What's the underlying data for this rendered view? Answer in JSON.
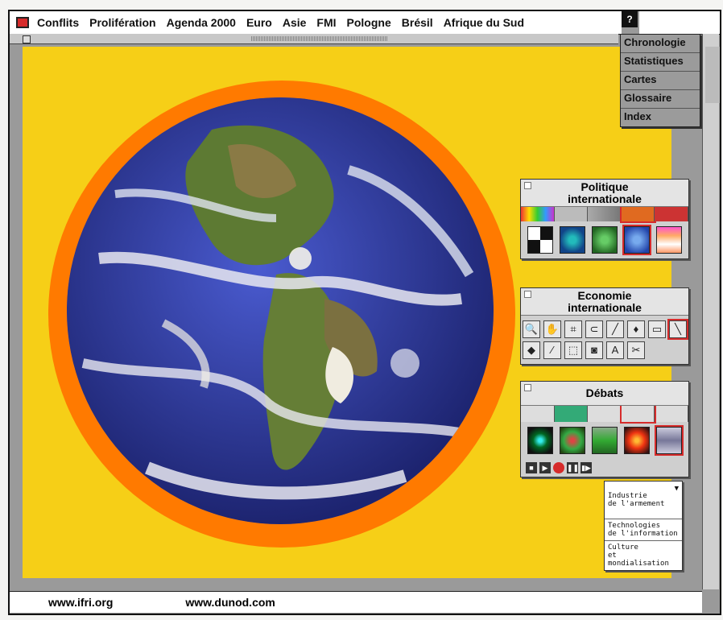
{
  "menubar": {
    "items": [
      "Conflits",
      "Prolifération",
      "Agenda 2000",
      "Euro",
      "Asie",
      "FMI",
      "Pologne",
      "Brésil",
      "Afrique du Sud"
    ],
    "help_label": "?"
  },
  "help_menu": {
    "items": [
      "Chronologie",
      "Statistiques",
      "Cartes",
      "Glossaire",
      "Index"
    ]
  },
  "palettes": {
    "politique": {
      "title_line1": "Politique",
      "title_line2": "internationale"
    },
    "economie": {
      "title_line1": "Economie",
      "title_line2": "internationale"
    },
    "debats": {
      "title": "Débats"
    }
  },
  "popup": {
    "items": [
      "Industrie\nde l'armement",
      "Technologies\nde l'information",
      "Culture\net mondialisation"
    ]
  },
  "status": {
    "link1": "www.ifri.org",
    "link2": "www.dunod.com"
  },
  "colors": {
    "accent": "#d62b2b",
    "background": "#f6cf17",
    "halo": "#ff7a00",
    "ocean": "#2c3a9c"
  }
}
